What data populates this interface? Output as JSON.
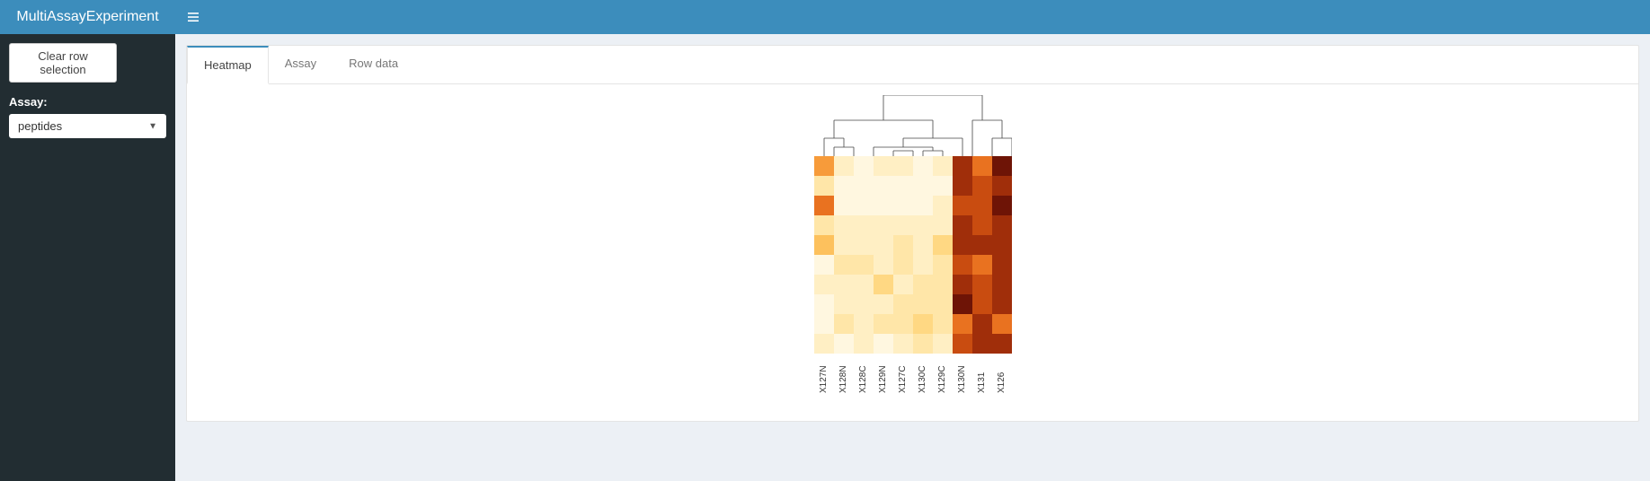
{
  "app": {
    "title": "MultiAssayExperiment"
  },
  "sidebar": {
    "clear_button": "Clear row selection",
    "assay_label": "Assay:",
    "assay_selected": "peptides"
  },
  "tabs": [
    {
      "label": "Heatmap",
      "active": true
    },
    {
      "label": "Assay",
      "active": false
    },
    {
      "label": "Row data",
      "active": false
    }
  ],
  "chart_data": {
    "type": "heatmap",
    "columns": [
      "X127N",
      "X128N",
      "X128C",
      "X129N",
      "X127C",
      "X130C",
      "X129C",
      "X130N",
      "X131",
      "X126"
    ],
    "palette": [
      "#fff7e0",
      "#ffefc4",
      "#ffe6a8",
      "#ffd883",
      "#fdc15d",
      "#f79b3a",
      "#e97220",
      "#c94c10",
      "#a02e0a",
      "#6e1406"
    ],
    "values": [
      [
        5,
        1,
        0,
        1,
        1,
        0,
        1,
        8,
        6,
        9
      ],
      [
        2,
        0,
        0,
        0,
        0,
        0,
        0,
        8,
        7,
        8
      ],
      [
        6,
        0,
        0,
        0,
        0,
        0,
        1,
        7,
        7,
        9
      ],
      [
        2,
        1,
        1,
        1,
        1,
        1,
        1,
        8,
        7,
        8
      ],
      [
        4,
        1,
        1,
        1,
        2,
        1,
        3,
        8,
        8,
        8
      ],
      [
        0,
        2,
        2,
        1,
        2,
        1,
        2,
        7,
        6,
        8
      ],
      [
        1,
        1,
        1,
        3,
        1,
        2,
        2,
        8,
        7,
        8
      ],
      [
        0,
        1,
        1,
        1,
        2,
        2,
        2,
        9,
        7,
        8
      ],
      [
        0,
        2,
        1,
        2,
        2,
        3,
        2,
        6,
        8,
        6
      ],
      [
        1,
        0,
        1,
        0,
        1,
        2,
        1,
        7,
        8,
        8
      ]
    ]
  }
}
